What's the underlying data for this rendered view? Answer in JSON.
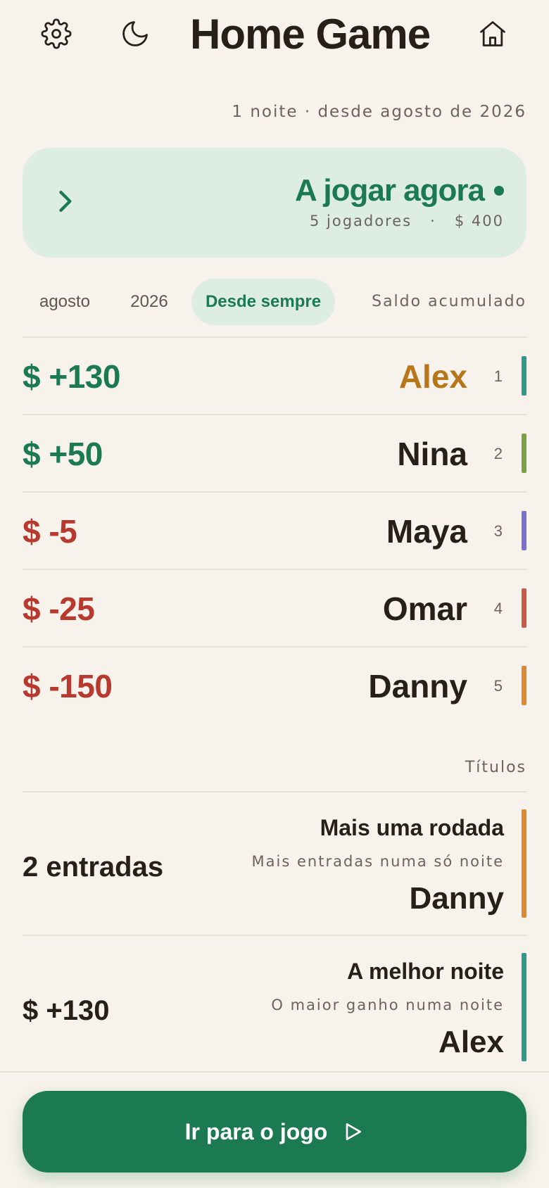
{
  "header": {
    "title": "Home Game",
    "icons": {
      "settings": "gear-icon",
      "theme": "moon-icon",
      "home": "home-icon"
    }
  },
  "meta_line": "1 noite · desde agosto de 2026",
  "live": {
    "title": "A jogar agora",
    "players": "5 jogadores",
    "separator": "·",
    "pot": "$ 400",
    "icon": "chevron-right-icon"
  },
  "filters": {
    "month": "agosto",
    "year": "2026",
    "all_time": "Desde sempre",
    "selected": "Desde sempre",
    "balance_label": "Saldo acumulado"
  },
  "leaderboard": [
    {
      "amount": "$ +130",
      "name": "Alex",
      "rank": "1",
      "color": "#2f9a8a",
      "positive": true
    },
    {
      "amount": "$ +50",
      "name": "Nina",
      "rank": "2",
      "color": "#7aa444",
      "positive": true
    },
    {
      "amount": "$ -5",
      "name": "Maya",
      "rank": "3",
      "color": "#7b6fd0",
      "positive": false
    },
    {
      "amount": "$ -25",
      "name": "Omar",
      "rank": "4",
      "color": "#c95a48",
      "positive": false
    },
    {
      "amount": "$ -150",
      "name": "Danny",
      "rank": "5",
      "color": "#dd8a32",
      "positive": false
    }
  ],
  "titles_label": "Títulos",
  "titles": [
    {
      "value": "2 entradas",
      "name": "Mais uma rodada",
      "desc": "Mais entradas numa só noite",
      "player": "Danny",
      "color": "#dd8a32"
    },
    {
      "value": "$ +130",
      "name": "A melhor noite",
      "desc": "O maior ganho numa noite",
      "player": "Alex",
      "color": "#2f9a8a"
    }
  ],
  "cta": {
    "label": "Ir para o jogo",
    "icon": "play-icon"
  },
  "colors": {
    "accent": "#1c7a52",
    "negative": "#b83a2e",
    "leader": "#b8761a",
    "background": "#f7f2ec"
  }
}
